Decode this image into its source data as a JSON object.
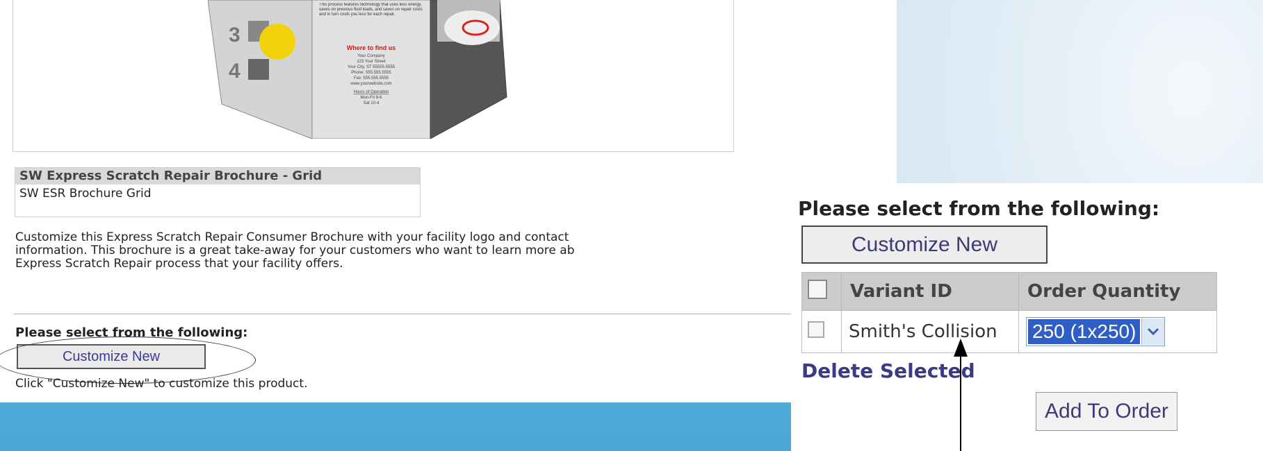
{
  "brochure_preview": {
    "step3_label": "3",
    "step4_label": "4",
    "body_text": "This process features technology that uses less energy, saves on previous fluid loads, and saves on repair costs and in turn costs you less for each repair.",
    "where_heading": "Where to find us",
    "company": "Your Company",
    "address_lines": [
      "123 Your Street",
      "Your City, ST 55555-5555",
      "Phone: 555.555.5555",
      "Fax: 555.555.5555",
      "www.yourwebsite.com"
    ],
    "hours_heading": "Hours of Operation",
    "hours_lines": [
      "Mon-Fri 8-6",
      "Sat 10-4"
    ]
  },
  "product": {
    "title": "SW Express Scratch Repair Brochure - Grid",
    "subtitle": "SW ESR Brochure Grid",
    "description_lines": [
      "Customize this Express Scratch Repair Consumer Brochure with your facility logo and contact",
      "information. This brochure is a great take-away for your customers who want to learn more ab",
      "Express Scratch Repair process that your facility offers."
    ]
  },
  "select_section": {
    "heading": "Please select from the following:",
    "customize_button": "Customize New",
    "hint": "Click \"Customize New\" to customize this product."
  },
  "zoom_section": {
    "heading": "Please select from the following:",
    "customize_button": "Customize New",
    "table": {
      "headers": [
        "Variant ID",
        "Order Quantity"
      ],
      "rows": [
        {
          "variant_id": "Smith's Collision",
          "quantity": "250 (1x250)"
        }
      ]
    },
    "delete_link": "Delete Selected",
    "add_button": "Add To Order"
  },
  "colors": {
    "link": "#3a3a8a",
    "select_highlight": "#2f5fc6",
    "title_bar": "#d9d9d9"
  },
  "icons": {
    "select_arrow": "chevron-down-icon",
    "annotation_arrow": "arrow-up-icon"
  }
}
